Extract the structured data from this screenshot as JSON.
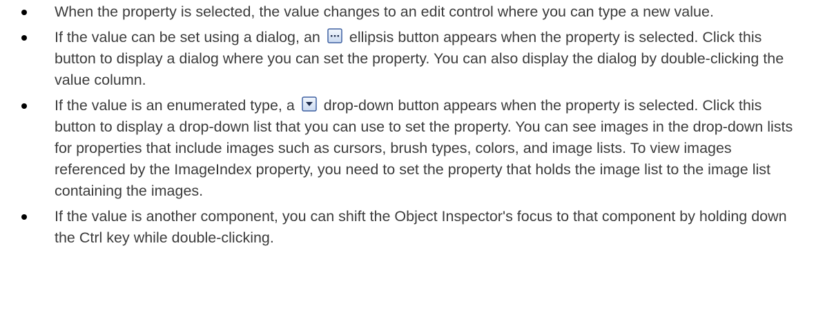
{
  "bullets": [
    {
      "text_before": "When the property is selected, the value changes to an edit control where you can type a new value.",
      "icon": null,
      "text_after": ""
    },
    {
      "text_before": "If the value can be set using a dialog, an",
      "icon": "ellipsis-button-icon",
      "text_after": "ellipsis button appears when the property is selected. Click this button to display a dialog where you can set the property. You can also display the dialog by double-clicking the value column."
    },
    {
      "text_before": "If the value is an enumerated type, a",
      "icon": "dropdown-button-icon",
      "text_after": "drop-down button appears when the property is selected. Click this button to display a drop-down list that you can use to set the property. You can see images in the drop-down lists for properties that include images such as cursors, brush types, colors, and image lists. To view images referenced by the ImageIndex property, you need to set the property that holds the image list to the image list containing the images."
    },
    {
      "text_before": "If the value is another component, you can shift the Object Inspector's focus to that component by holding down the Ctrl key while double-clicking.",
      "icon": null,
      "text_after": ""
    }
  ],
  "colors": {
    "text": "#3b3b3b",
    "bullet": "#000000",
    "icon_border": "#3c5fa0",
    "icon_fill": "#dbe6f6"
  }
}
